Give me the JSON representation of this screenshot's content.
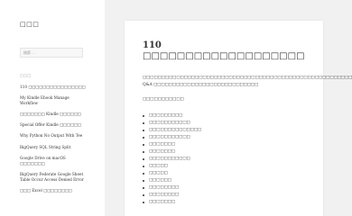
{
  "site": {
    "title": "□□□"
  },
  "search": {
    "placeholder": "検索 ..."
  },
  "recent": {
    "heading": "□□□",
    "items": [
      "110 □□□□□□□□□□□□□□□□",
      "My Kindle Ebook Manage Workflow",
      "□□□□□□□ Kindle □□□□□□",
      "Special Offer Kindle □□□□□□",
      "Why Python No Output With Tee",
      "BigQuery SQL String Split",
      "Google Drive on macOS □□□□□□□",
      "BigQuery Federate Google Sheet Table Occur Access Denied Error",
      "□□□ Excel □□□□□□□□"
    ]
  },
  "post": {
    "title": "110 □□□□□□□□□□□□□□□□□□□",
    "intro": "□□□□□□□□□□□□□□□□□□□□□□□□□□□□□□□□□□□□□□□□□□□□□□□□□□□□□□□□ Q&A □□□□□□□□□□□□□□□□□□□□□□□□□□□□",
    "subheading": "□□□□□□□□□□□",
    "list": [
      "□□□□□□□□□",
      "□□□□□□□□□□□",
      "□□□□□□□□□□□□□□",
      "□□□□□□□□□□□",
      "□□□□□□□",
      "□□□□□□□",
      "□□□□□□□□□□□",
      "□□□□□",
      "□□□□□",
      "□□□□□□",
      "□□□□□□□□",
      "□□□□□□□□",
      "□□□□□□□"
    ]
  }
}
